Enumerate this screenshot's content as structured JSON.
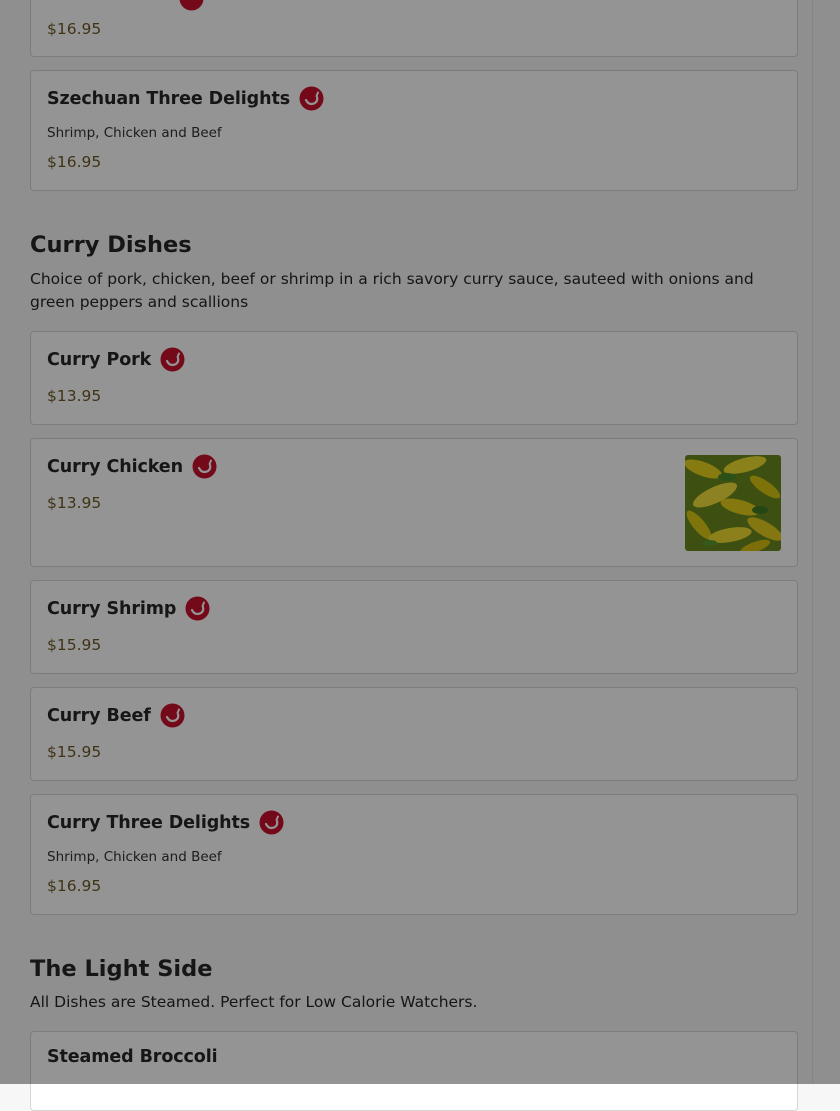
{
  "colors": {
    "spicy_badge": "#c8102e",
    "price": "#6e5a26"
  },
  "szechuan": {
    "prev_price": "$16.95",
    "three_delights": {
      "name": "Szechuan Three Delights",
      "desc": "Shrimp, Chicken and Beef",
      "price": "$16.95",
      "icon": "spicy-pepper-icon"
    }
  },
  "curry": {
    "title": "Curry Dishes",
    "desc": "Choice of pork, chicken, beef or shrimp in a rich savory curry sauce, sauteed with onions and green peppers and scallions",
    "items": [
      {
        "name": "Curry Pork",
        "price": "$13.95"
      },
      {
        "name": "Curry Chicken",
        "price": "$13.95",
        "image": "curry-chicken-photo"
      },
      {
        "name": "Curry Shrimp",
        "price": "$15.95"
      },
      {
        "name": "Curry Beef",
        "price": "$15.95"
      },
      {
        "name": "Curry Three Delights",
        "desc": "Shrimp, Chicken and Beef",
        "price": "$16.95"
      }
    ]
  },
  "light_side": {
    "title": "The Light Side",
    "desc": "All Dishes are Steamed. Perfect for Low Calorie Watchers.",
    "items": [
      {
        "name": "Steamed Broccoli"
      }
    ]
  }
}
